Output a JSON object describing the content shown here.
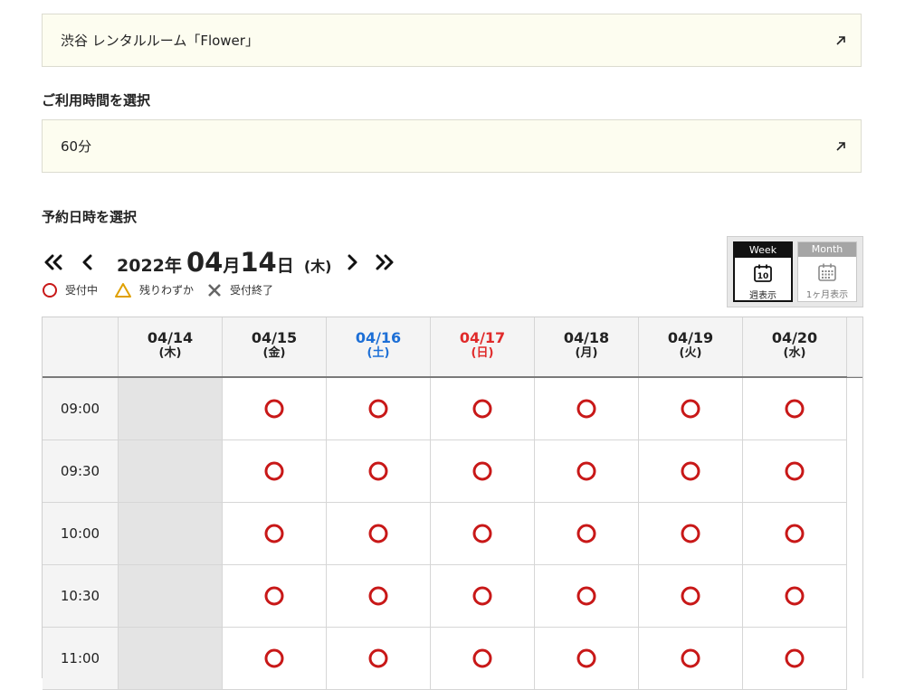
{
  "room_select": {
    "value": "渋谷 レンタルルーム「Flower」",
    "icon": "arrow-up-right-icon"
  },
  "time_heading": "ご利用時間を選択",
  "duration_select": {
    "value": "60分",
    "icon": "arrow-up-right-icon"
  },
  "date_heading": "予約日時を選択",
  "nav": {
    "year": "2022",
    "year_unit": "年",
    "month": "04",
    "month_unit": "月",
    "day": "14",
    "day_unit": "日",
    "weekday": "(木)"
  },
  "legend": {
    "available": "受付中",
    "few_left": "残りわずか",
    "closed": "受付終了"
  },
  "view_toggle": {
    "week_tab": "Week",
    "week_label": "週表示",
    "week_icon_day": "10",
    "month_tab": "Month",
    "month_label": "1ヶ月表示",
    "selected": "week"
  },
  "colors": {
    "available": "#c81818",
    "few_left": "#e0a000",
    "saturday": "#1d6fd6",
    "sunday": "#e02a2a"
  },
  "days": [
    {
      "date": "04/14",
      "dow": "(木)",
      "kind": "weekday"
    },
    {
      "date": "04/15",
      "dow": "(金)",
      "kind": "weekday"
    },
    {
      "date": "04/16",
      "dow": "(土)",
      "kind": "sat"
    },
    {
      "date": "04/17",
      "dow": "(日)",
      "kind": "sun"
    },
    {
      "date": "04/18",
      "dow": "(月)",
      "kind": "weekday"
    },
    {
      "date": "04/19",
      "dow": "(火)",
      "kind": "weekday"
    },
    {
      "date": "04/20",
      "dow": "(水)",
      "kind": "weekday"
    }
  ],
  "slots": [
    {
      "time": "09:00",
      "status": [
        "closed",
        "available",
        "available",
        "available",
        "available",
        "available",
        "available"
      ]
    },
    {
      "time": "09:30",
      "status": [
        "closed",
        "available",
        "available",
        "available",
        "available",
        "available",
        "available"
      ]
    },
    {
      "time": "10:00",
      "status": [
        "closed",
        "available",
        "available",
        "available",
        "available",
        "available",
        "available"
      ]
    },
    {
      "time": "10:30",
      "status": [
        "closed",
        "available",
        "available",
        "available",
        "available",
        "available",
        "available"
      ]
    },
    {
      "time": "11:00",
      "status": [
        "closed",
        "available",
        "available",
        "available",
        "available",
        "available",
        "available"
      ]
    }
  ]
}
